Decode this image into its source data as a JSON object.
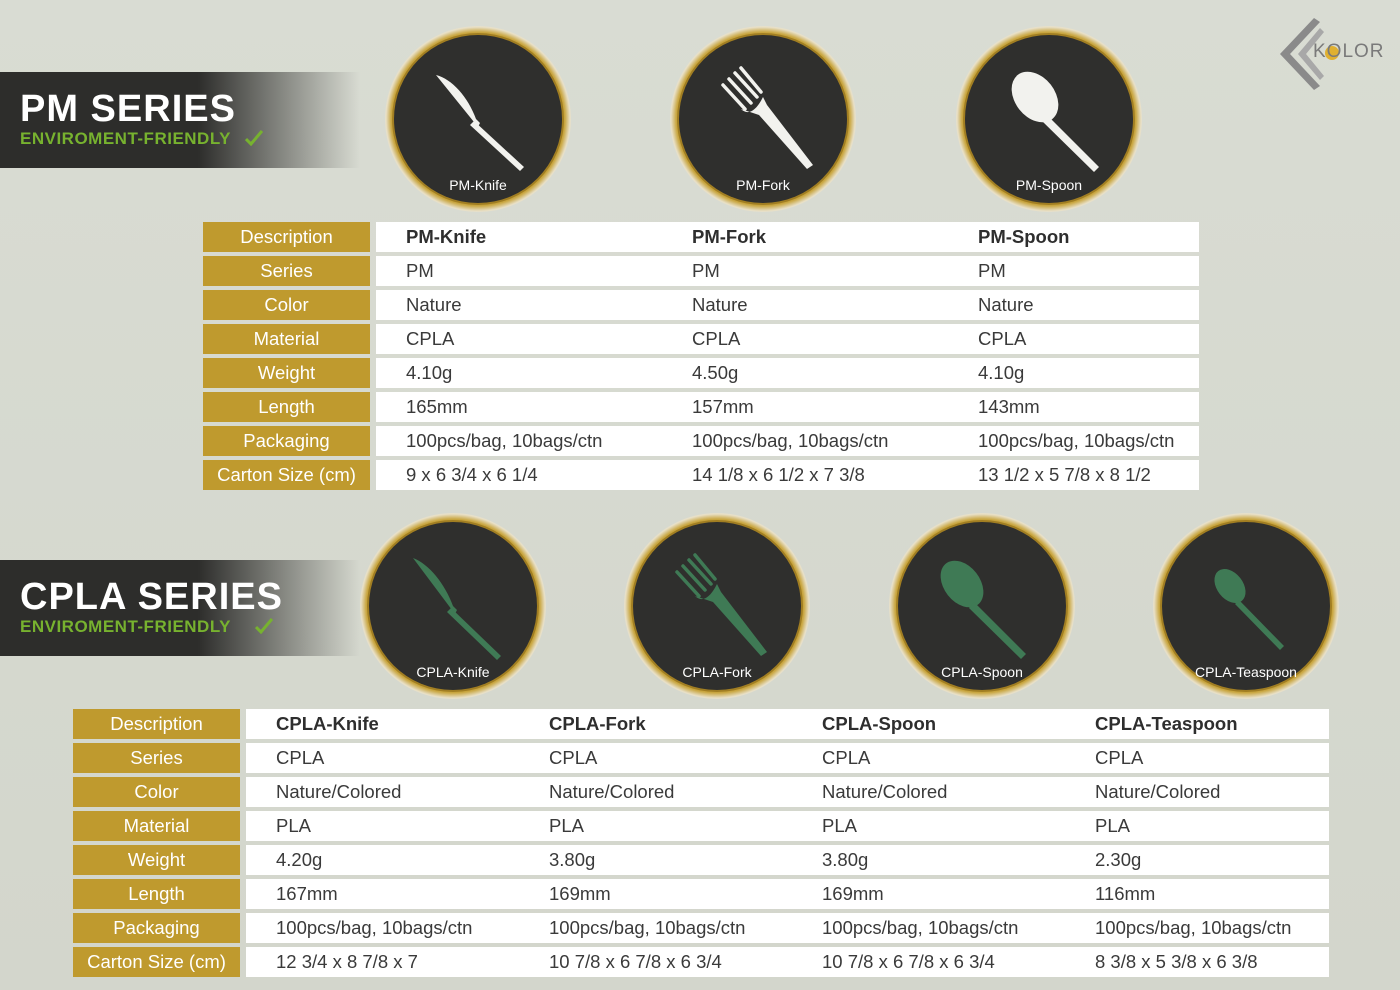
{
  "brand": {
    "logo_text": "KOLOR"
  },
  "colors": {
    "gold": "#bf9a2e",
    "dark": "#2d2d2b",
    "green": "#77b22f",
    "cpla_green": "#3f7a55",
    "pm_white": "#f2f2ee"
  },
  "pm": {
    "title": "PM SERIES",
    "subtitle": "ENVIROMENT-FRIENDLY",
    "products": [
      {
        "caption": "PM-Knife",
        "icon": "knife-icon"
      },
      {
        "caption": "PM-Fork",
        "icon": "fork-icon"
      },
      {
        "caption": "PM-Spoon",
        "icon": "spoon-icon"
      }
    ],
    "labels": [
      "Description",
      "Series",
      "Color",
      "Material",
      "Weight",
      "Length",
      "Packaging",
      "Carton Size (cm)"
    ],
    "rows": [
      [
        "PM-Knife",
        "PM-Fork",
        "PM-Spoon"
      ],
      [
        "PM",
        "PM",
        "PM"
      ],
      [
        "Nature",
        "Nature",
        "Nature"
      ],
      [
        "CPLA",
        "CPLA",
        "CPLA"
      ],
      [
        "4.10g",
        "4.50g",
        "4.10g"
      ],
      [
        "165mm",
        "157mm",
        "143mm"
      ],
      [
        "100pcs/bag, 10bags/ctn",
        "100pcs/bag, 10bags/ctn",
        "100pcs/bag, 10bags/ctn"
      ],
      [
        "9 x 6 3/4 x 6 1/4",
        "14 1/8 x 6 1/2 x 7 3/8",
        "13 1/2 x 5 7/8 x 8 1/2"
      ]
    ]
  },
  "cpla": {
    "title": "CPLA SERIES",
    "subtitle": "ENVIROMENT-FRIENDLY",
    "products": [
      {
        "caption": "CPLA-Knife",
        "icon": "knife-icon"
      },
      {
        "caption": "CPLA-Fork",
        "icon": "fork-icon"
      },
      {
        "caption": "CPLA-Spoon",
        "icon": "spoon-icon"
      },
      {
        "caption": "CPLA-Teaspoon",
        "icon": "teaspoon-icon"
      }
    ],
    "labels": [
      "Description",
      "Series",
      "Color",
      "Material",
      "Weight",
      "Length",
      "Packaging",
      "Carton Size (cm)"
    ],
    "rows": [
      [
        "CPLA-Knife",
        "CPLA-Fork",
        "CPLA-Spoon",
        "CPLA-Teaspoon"
      ],
      [
        "CPLA",
        "CPLA",
        "CPLA",
        "CPLA"
      ],
      [
        "Nature/Colored",
        "Nature/Colored",
        "Nature/Colored",
        "Nature/Colored"
      ],
      [
        "PLA",
        "PLA",
        "PLA",
        "PLA"
      ],
      [
        "4.20g",
        "3.80g",
        "3.80g",
        "2.30g"
      ],
      [
        "167mm",
        "169mm",
        "169mm",
        "116mm"
      ],
      [
        "100pcs/bag, 10bags/ctn",
        "100pcs/bag, 10bags/ctn",
        "100pcs/bag, 10bags/ctn",
        "100pcs/bag, 10bags/ctn"
      ],
      [
        "12 3/4 x 8 7/8 x 7",
        "10 7/8 x 6 7/8 x 6 3/4",
        "10 7/8 x 6 7/8 x 6 3/4",
        "8 3/8 x 5 3/8 x 6 3/8"
      ]
    ]
  }
}
